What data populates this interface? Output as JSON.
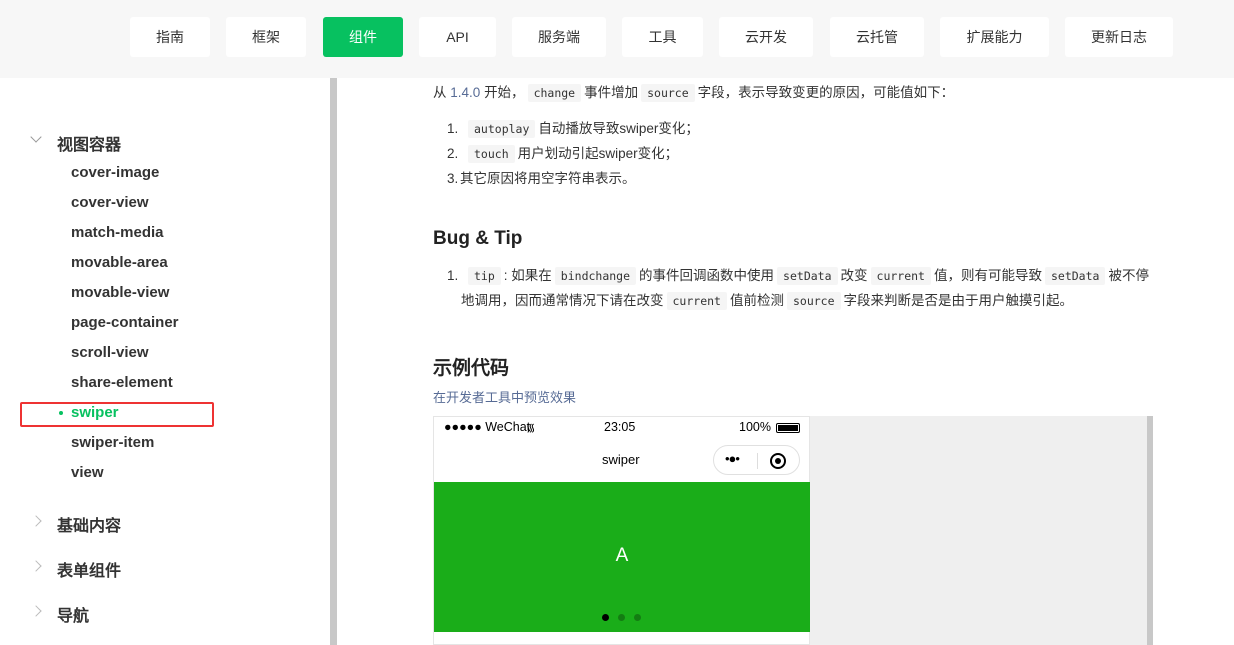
{
  "nav": {
    "items": [
      "指南",
      "框架",
      "组件",
      "API",
      "服务端",
      "工具",
      "云开发",
      "云托管",
      "扩展能力",
      "更新日志"
    ],
    "active": "组件"
  },
  "sidebar": {
    "group_view_container": "视图容器",
    "items": [
      "cover-image",
      "cover-view",
      "match-media",
      "movable-area",
      "movable-view",
      "page-container",
      "scroll-view",
      "share-element",
      "swiper",
      "swiper-item",
      "view"
    ],
    "active": "swiper",
    "group_basic": "基础内容",
    "group_form": "表单组件",
    "group_nav": "导航"
  },
  "content": {
    "intro_prefix": "从",
    "version": "1.4.0",
    "intro_mid": "开始，",
    "code_change": "change",
    "intro_mid2": "事件增加",
    "code_source": "source",
    "intro_suffix": "字段，表示导致变更的原因，可能值如下：",
    "list": [
      {
        "num": "1.",
        "code": "autoplay",
        "text": "自动播放导致swiper变化；"
      },
      {
        "num": "2.",
        "code": "touch",
        "text": "用户划动引起swiper变化；"
      },
      {
        "num": "3.",
        "text": "其它原因将用空字符串表示。"
      }
    ],
    "bug_title": "Bug & Tip",
    "tip": {
      "num": "1.",
      "code_tip": "tip",
      "t1": ": 如果在",
      "code_bindchange": "bindchange",
      "t2": "的事件回调函数中使用",
      "code_setdata": "setData",
      "t3": "改变",
      "code_current": "current",
      "t4": "值，则有可能导致",
      "code_setdata2": "setData",
      "t5": "被不停",
      "t6": "地调用，因而通常情况下请在改变",
      "code_current2": "current",
      "t7": "值前检测",
      "code_source": "source",
      "t8": "字段来判断是否是由于用户触摸引起。"
    },
    "example_title": "示例代码",
    "preview_link": "在开发者工具中预览效果"
  },
  "phone": {
    "carrier": "●●●●● WeChat",
    "time": "23:05",
    "battery_text": "100%",
    "title": "swiper",
    "capsule_dots": "•●•",
    "slide_label": "A",
    "swiper_color": "#1aad19",
    "indicator_count": 3,
    "indicator_active": 0
  }
}
